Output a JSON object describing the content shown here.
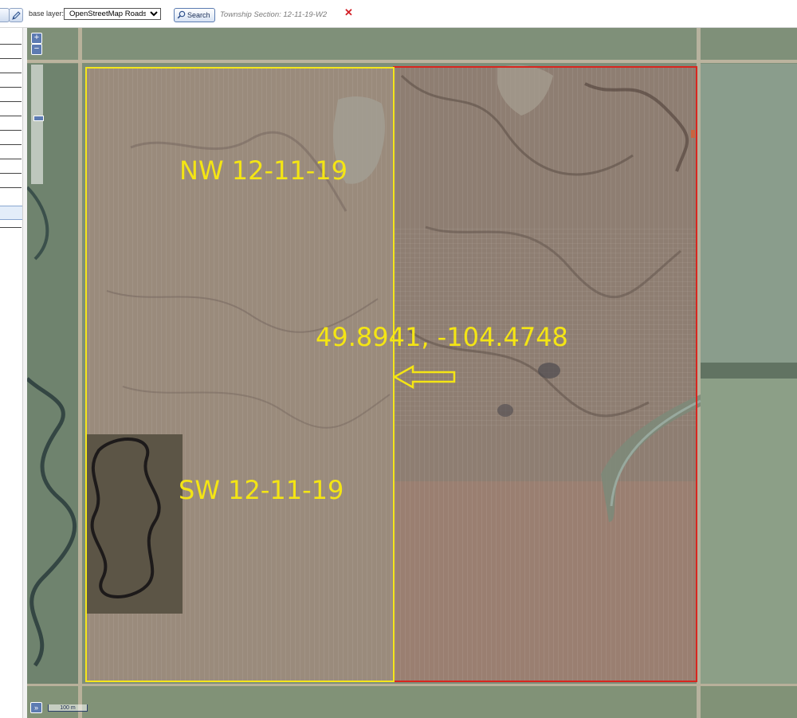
{
  "toolbar": {
    "base_layer_label": "base layer:",
    "base_layer_selected": "OpenStreetMap Roads",
    "search_label": "Search",
    "township_section": "Township Section: 12-11-19-W2",
    "clear_symbol": "✕"
  },
  "map": {
    "labels": {
      "nw_quarter": "NW 12-11-19",
      "sw_quarter": "SW 12-11-19",
      "coordinates": "49.8941, -104.4748"
    },
    "scale_label": "100 m",
    "zoom_in_symbol": "+",
    "zoom_out_symbol": "−",
    "layer_switcher_symbol": "»",
    "zoom_level_fraction": 0.45
  },
  "colors": {
    "west_half_outline": "#f5e61b",
    "section_outline": "#d9261f",
    "label_text": "#f4e514",
    "arrow_outline": "#f4e514",
    "control_blue": "#5d7bb2"
  },
  "icons": {
    "search": "magnifier-icon",
    "clear": "close-icon",
    "draw": "pencil-icon",
    "arrow": "left-arrow-icon"
  }
}
